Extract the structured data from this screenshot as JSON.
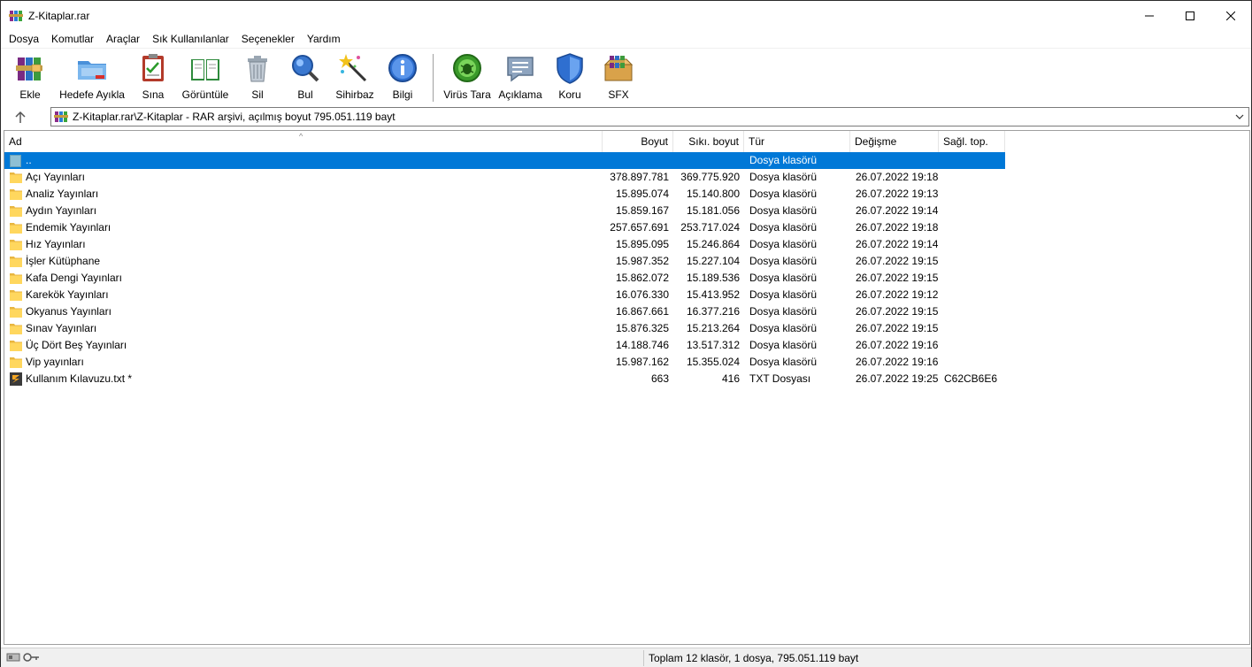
{
  "window": {
    "title": "Z-Kitaplar.rar",
    "minimize": "—",
    "maximize": "☐",
    "close": "✕"
  },
  "menu": [
    "Dosya",
    "Komutlar",
    "Araçlar",
    "Sık Kullanılanlar",
    "Seçenekler",
    "Yardım"
  ],
  "toolbar": {
    "add": "Ekle",
    "extract": "Hedefe Ayıkla",
    "test": "Sına",
    "view": "Görüntüle",
    "delete": "Sil",
    "find": "Bul",
    "wizard": "Sihirbaz",
    "info": "Bilgi",
    "virus": "Virüs Tara",
    "comment": "Açıklama",
    "protect": "Koru",
    "sfx": "SFX"
  },
  "address": {
    "path": "Z-Kitaplar.rar\\Z-Kitaplar - RAR arşivi, açılmış boyut 795.051.119 bayt"
  },
  "columns": {
    "name": "Ad",
    "size": "Boyut",
    "packed": "Sıkı. boyut",
    "type": "Tür",
    "modified": "Değişme",
    "crc": "Sağl. top."
  },
  "rows": [
    {
      "name": "..",
      "size": "",
      "packed": "",
      "type": "Dosya klasörü",
      "modified": "",
      "crc": "",
      "kind": "up"
    },
    {
      "name": "Açı Yayınları",
      "size": "378.897.781",
      "packed": "369.775.920",
      "type": "Dosya klasörü",
      "modified": "26.07.2022 19:18",
      "crc": "",
      "kind": "folder"
    },
    {
      "name": "Analiz Yayınları",
      "size": "15.895.074",
      "packed": "15.140.800",
      "type": "Dosya klasörü",
      "modified": "26.07.2022 19:13",
      "crc": "",
      "kind": "folder"
    },
    {
      "name": "Aydın Yayınları",
      "size": "15.859.167",
      "packed": "15.181.056",
      "type": "Dosya klasörü",
      "modified": "26.07.2022 19:14",
      "crc": "",
      "kind": "folder"
    },
    {
      "name": "Endemik Yayınları",
      "size": "257.657.691",
      "packed": "253.717.024",
      "type": "Dosya klasörü",
      "modified": "26.07.2022 19:18",
      "crc": "",
      "kind": "folder"
    },
    {
      "name": "Hız Yayınları",
      "size": "15.895.095",
      "packed": "15.246.864",
      "type": "Dosya klasörü",
      "modified": "26.07.2022 19:14",
      "crc": "",
      "kind": "folder"
    },
    {
      "name": "İşler Kütüphane",
      "size": "15.987.352",
      "packed": "15.227.104",
      "type": "Dosya klasörü",
      "modified": "26.07.2022 19:15",
      "crc": "",
      "kind": "folder"
    },
    {
      "name": "Kafa Dengi Yayınları",
      "size": "15.862.072",
      "packed": "15.189.536",
      "type": "Dosya klasörü",
      "modified": "26.07.2022 19:15",
      "crc": "",
      "kind": "folder"
    },
    {
      "name": "Karekök Yayınları",
      "size": "16.076.330",
      "packed": "15.413.952",
      "type": "Dosya klasörü",
      "modified": "26.07.2022 19:12",
      "crc": "",
      "kind": "folder"
    },
    {
      "name": "Okyanus Yayınları",
      "size": "16.867.661",
      "packed": "16.377.216",
      "type": "Dosya klasörü",
      "modified": "26.07.2022 19:15",
      "crc": "",
      "kind": "folder"
    },
    {
      "name": "Sınav Yayınları",
      "size": "15.876.325",
      "packed": "15.213.264",
      "type": "Dosya klasörü",
      "modified": "26.07.2022 19:15",
      "crc": "",
      "kind": "folder"
    },
    {
      "name": "Üç Dört Beş Yayınları",
      "size": "14.188.746",
      "packed": "13.517.312",
      "type": "Dosya klasörü",
      "modified": "26.07.2022 19:16",
      "crc": "",
      "kind": "folder"
    },
    {
      "name": "Vip yayınları",
      "size": "15.987.162",
      "packed": "15.355.024",
      "type": "Dosya klasörü",
      "modified": "26.07.2022 19:16",
      "crc": "",
      "kind": "folder"
    },
    {
      "name": "Kullanım Kılavuzu.txt *",
      "size": "663",
      "packed": "416",
      "type": "TXT Dosyası",
      "modified": "26.07.2022 19:25",
      "crc": "C62CB6E6",
      "kind": "txt"
    }
  ],
  "status": {
    "summary": "Toplam 12 klasör, 1 dosya, 795.051.119 bayt"
  }
}
